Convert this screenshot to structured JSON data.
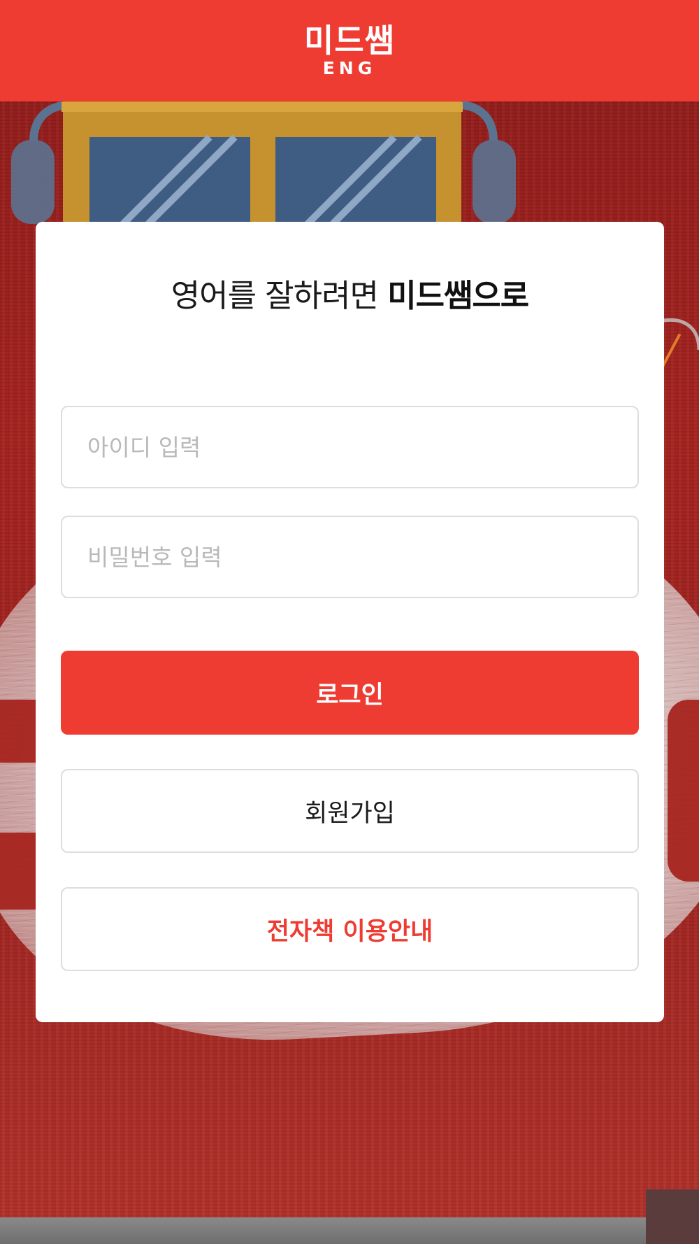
{
  "header": {
    "logo_main": "미드쌤",
    "logo_sub": "ENG",
    "background_color": "#ee3c33"
  },
  "login": {
    "tagline_prefix": "영어를 잘하려면",
    "tagline_brand": "미드쌤으로",
    "id_placeholder": "아이디 입력",
    "password_placeholder": "비밀번호 입력",
    "login_label": "로그인",
    "signup_label": "회원가입",
    "ebook_guide_label": "전자책 이용안내"
  },
  "colors": {
    "accent": "#ee3c33",
    "background_red": "#a3221f",
    "field_border": "#dddddd",
    "placeholder": "#b9b9b9"
  }
}
